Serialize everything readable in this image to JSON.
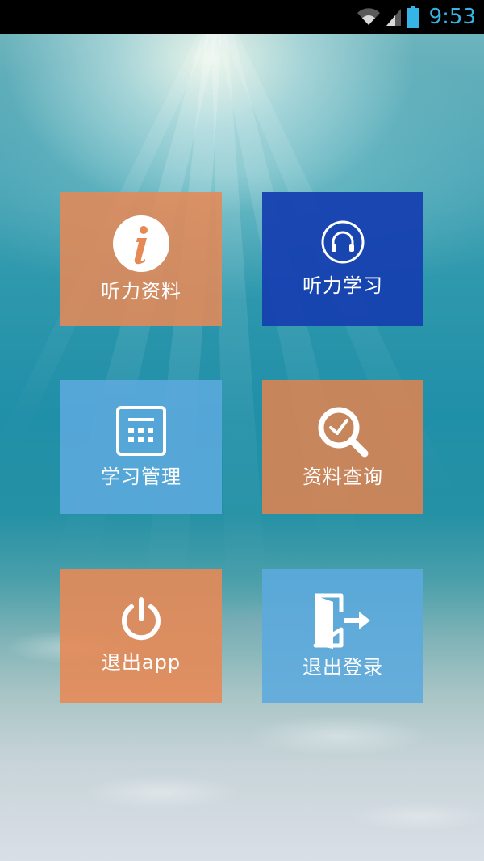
{
  "status_bar": {
    "time": "9:53",
    "icons": [
      "wifi-icon",
      "cellular-signal-icon",
      "battery-icon"
    ],
    "clock_color": "#35b5e5"
  },
  "menu": {
    "tiles": [
      {
        "label": "听力资料",
        "icon": "info-icon",
        "color": "#e58956"
      },
      {
        "label": "听力学习",
        "icon": "headphones-icon",
        "color": "#1640b0"
      },
      {
        "label": "学习管理",
        "icon": "calendar-grid-icon",
        "color": "#5caade"
      },
      {
        "label": "资料查询",
        "icon": "search-check-icon",
        "color": "#d68456"
      },
      {
        "label": "退出app",
        "icon": "power-icon",
        "color": "#e58956"
      },
      {
        "label": "退出登录",
        "icon": "exit-door-icon",
        "color": "#5caade"
      }
    ]
  }
}
